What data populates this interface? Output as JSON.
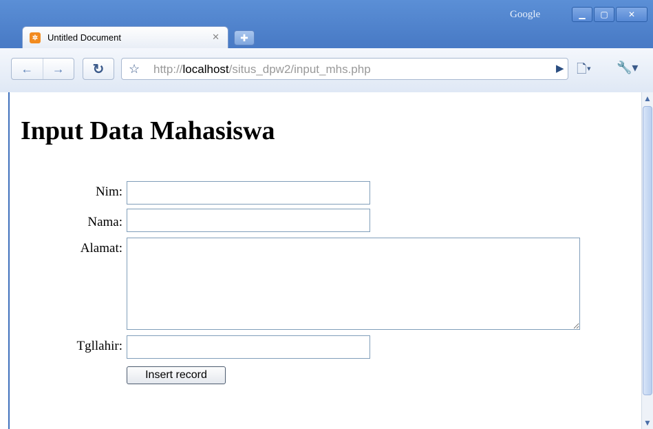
{
  "window": {
    "google_label": "Google",
    "minimize_icon": "minimize-icon",
    "maximize_icon": "maximize-icon",
    "close_icon": "close-icon"
  },
  "tabs": [
    {
      "title": "Untitled Document",
      "favicon": "xampp-icon",
      "active": true
    }
  ],
  "toolbar": {
    "url_scheme": "http://",
    "url_host": "localhost",
    "url_path": "/situs_dpw2/input_mhs.php"
  },
  "page": {
    "heading": "Input Data Mahasiswa",
    "form": {
      "nim_label": "Nim:",
      "nim_value": "",
      "nama_label": "Nama:",
      "nama_value": "",
      "alamat_label": "Alamat:",
      "alamat_value": "",
      "tgllahir_label": "Tgllahir:",
      "tgllahir_value": "",
      "submit_label": "Insert record"
    }
  },
  "colors": {
    "chrome_blue": "#4a7cc7",
    "field_border": "#7f9db9"
  }
}
